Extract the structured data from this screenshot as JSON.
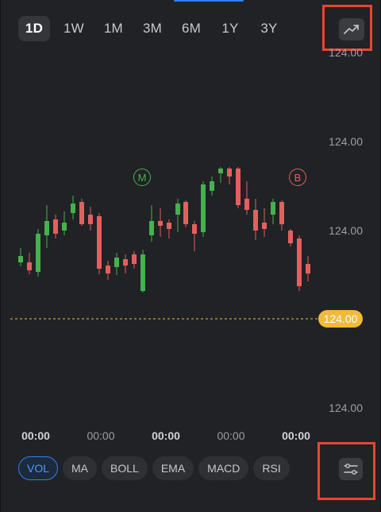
{
  "range_tabs": [
    {
      "label": "1D",
      "active": true
    },
    {
      "label": "1W",
      "active": false
    },
    {
      "label": "1M",
      "active": false
    },
    {
      "label": "3M",
      "active": false
    },
    {
      "label": "6M",
      "active": false
    },
    {
      "label": "1Y",
      "active": false
    },
    {
      "label": "3Y",
      "active": false
    }
  ],
  "chart_type_icon": "trend-line-icon",
  "settings_icon": "sliders-icon",
  "colors": {
    "up": "#45b14f",
    "down": "#e45f5f",
    "current_price": "#f2b93b",
    "active_accent": "#2f80ed",
    "highlight": "#e8462f"
  },
  "price_axis_labels": [
    "124.00",
    "124.00",
    "124.00",
    "124.00"
  ],
  "current_price": "124.00",
  "time_labels": [
    {
      "label": "00:00",
      "emphasis": true
    },
    {
      "label": "00:00",
      "emphasis": false
    },
    {
      "label": "00:00",
      "emphasis": true
    },
    {
      "label": "00:00",
      "emphasis": false
    },
    {
      "label": "00:00",
      "emphasis": true
    }
  ],
  "markers": [
    {
      "label": "M",
      "color": "#45b14f"
    },
    {
      "label": "B",
      "color": "#e45f5f"
    }
  ],
  "indicator_tabs": [
    {
      "label": "VOL",
      "active": true
    },
    {
      "label": "MA",
      "active": false
    },
    {
      "label": "BOLL",
      "active": false
    },
    {
      "label": "EMA",
      "active": false
    },
    {
      "label": "MACD",
      "active": false
    },
    {
      "label": "RSI",
      "active": false
    }
  ]
}
